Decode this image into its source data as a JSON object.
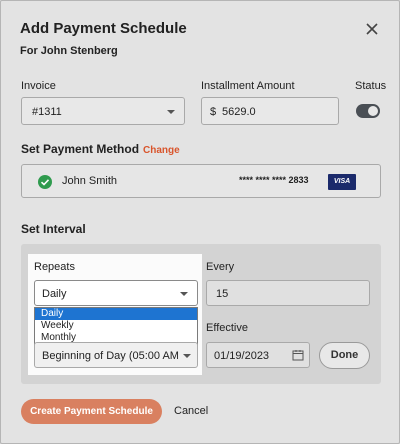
{
  "header": {
    "title": "Add Payment Schedule",
    "subtitle": "For John Stenberg"
  },
  "invoice": {
    "label": "Invoice",
    "value": "#1311"
  },
  "installment": {
    "label": "Installment Amount",
    "currency": "$",
    "value": "5629.0"
  },
  "status": {
    "label": "Status",
    "enabled": true
  },
  "payment_method": {
    "section_title": "Set Payment Method",
    "change_label": "Change",
    "holder": "John Smith",
    "card_masked": "**** **** **** 2833",
    "card_brand": "VISA"
  },
  "interval": {
    "section_title": "Set Interval",
    "repeats_label": "Repeats",
    "repeats_value": "Daily",
    "repeats_options": [
      "Daily",
      "Weekly",
      "Monthly"
    ],
    "selected_option": "Daily",
    "every_label": "Every",
    "every_value": "15",
    "effective_label": "Effective",
    "effective_time": "Beginning of Day (05:00 AM",
    "effective_date": "01/19/2023",
    "done_label": "Done"
  },
  "footer": {
    "create_label": "Create Payment Schedule",
    "cancel_label": "Cancel"
  },
  "colors": {
    "accent": "#d9552c",
    "primary_button": "#d98060",
    "selection": "#1e74d1",
    "success": "#2f9b4e"
  }
}
